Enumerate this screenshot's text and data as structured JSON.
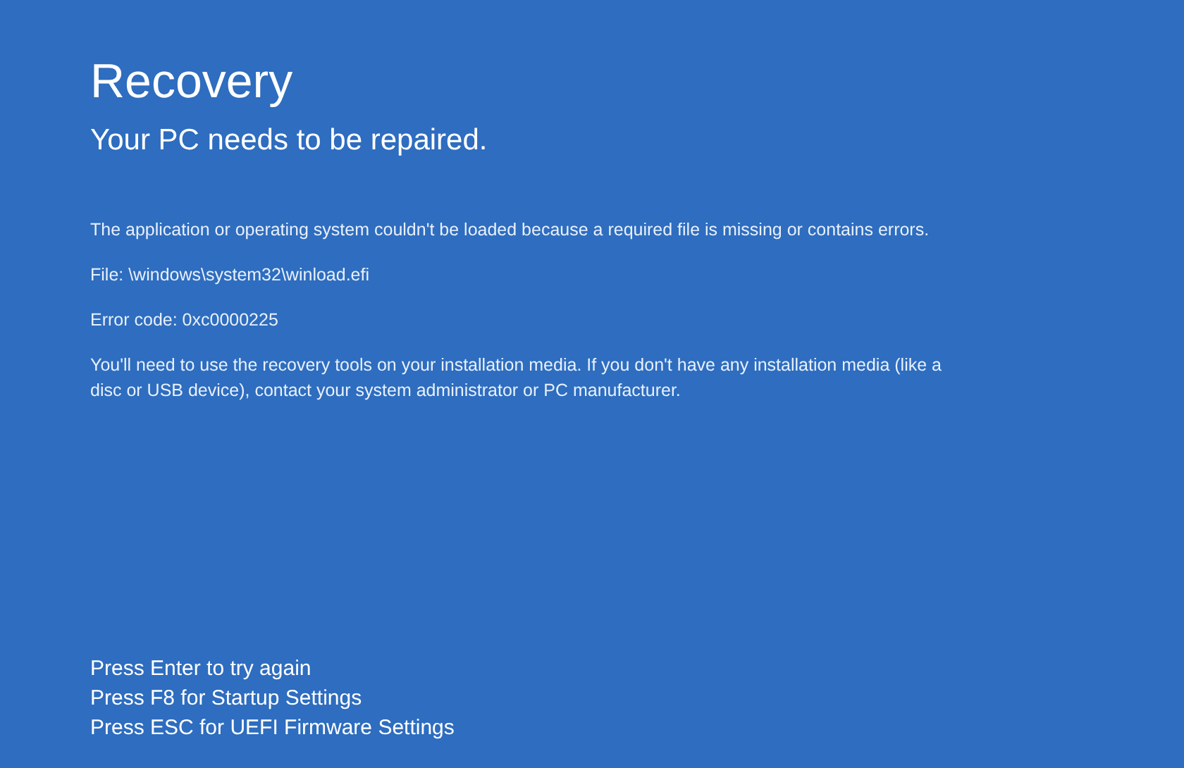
{
  "title": "Recovery",
  "subtitle": "Your PC needs to be repaired.",
  "paragraphs": [
    "The application or operating system couldn't be loaded because a required file is missing or contains errors.",
    "File: \\windows\\system32\\winload.efi",
    "Error code: 0xc0000225",
    "You'll need to use the recovery tools on your installation media. If you don't have any installation media (like a disc or USB device), contact your system administrator or PC manufacturer."
  ],
  "options": [
    "Press Enter to try again",
    "Press F8 for Startup Settings",
    "Press ESC for UEFI Firmware Settings"
  ]
}
